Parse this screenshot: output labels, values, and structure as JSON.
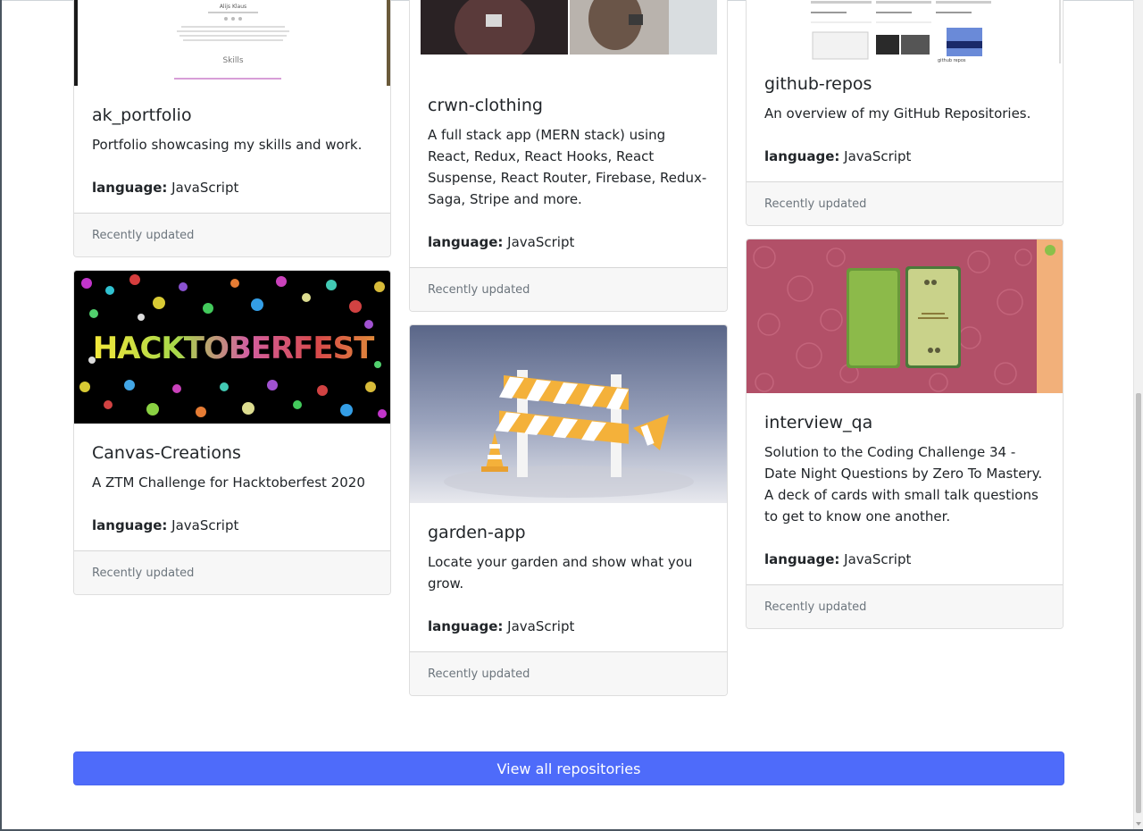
{
  "repos": [
    {
      "name": "ak_portfolio",
      "description": "Portfolio showcasing my skills and work.",
      "language_label": "language:",
      "language": "JavaScript",
      "footer": "Recently updated",
      "image": {
        "title": "Alijs Klaus",
        "subtitle": "Skills"
      }
    },
    {
      "name": "crwn-clothing",
      "description": "A full stack app (MERN stack) using React, Redux, React Hooks, React Suspense, React Router, Firebase, Redux-Saga, Stripe and more.",
      "language_label": "language:",
      "language": "JavaScript",
      "footer": "Recently updated"
    },
    {
      "name": "github-repos",
      "description": "An overview of my GitHub Repositories.",
      "language_label": "language:",
      "language": "JavaScript",
      "footer": "Recently updated",
      "image": {
        "caption": "github repos"
      }
    },
    {
      "name": "Canvas-Creations",
      "description": "A ZTM Challenge for Hacktoberfest 2020",
      "language_label": "language:",
      "language": "JavaScript",
      "footer": "Recently updated",
      "image": {
        "banner": "HACKTOBERFEST"
      }
    },
    {
      "name": "garden-app",
      "description": "Locate your garden and show what you grow.",
      "language_label": "language:",
      "language": "JavaScript",
      "footer": "Recently updated"
    },
    {
      "name": "interview_qa",
      "description": "Solution to the Coding Challenge 34 - Date Night Questions by Zero To Mastery. A deck of cards with small talk questions to get to know one another.",
      "language_label": "language:",
      "language": "JavaScript",
      "footer": "Recently updated"
    }
  ],
  "view_all_label": "View all repositories",
  "colors": {
    "accent": "#4e6bfa",
    "footer_bg": "#f7f7f7",
    "muted_text": "#6c757d"
  }
}
